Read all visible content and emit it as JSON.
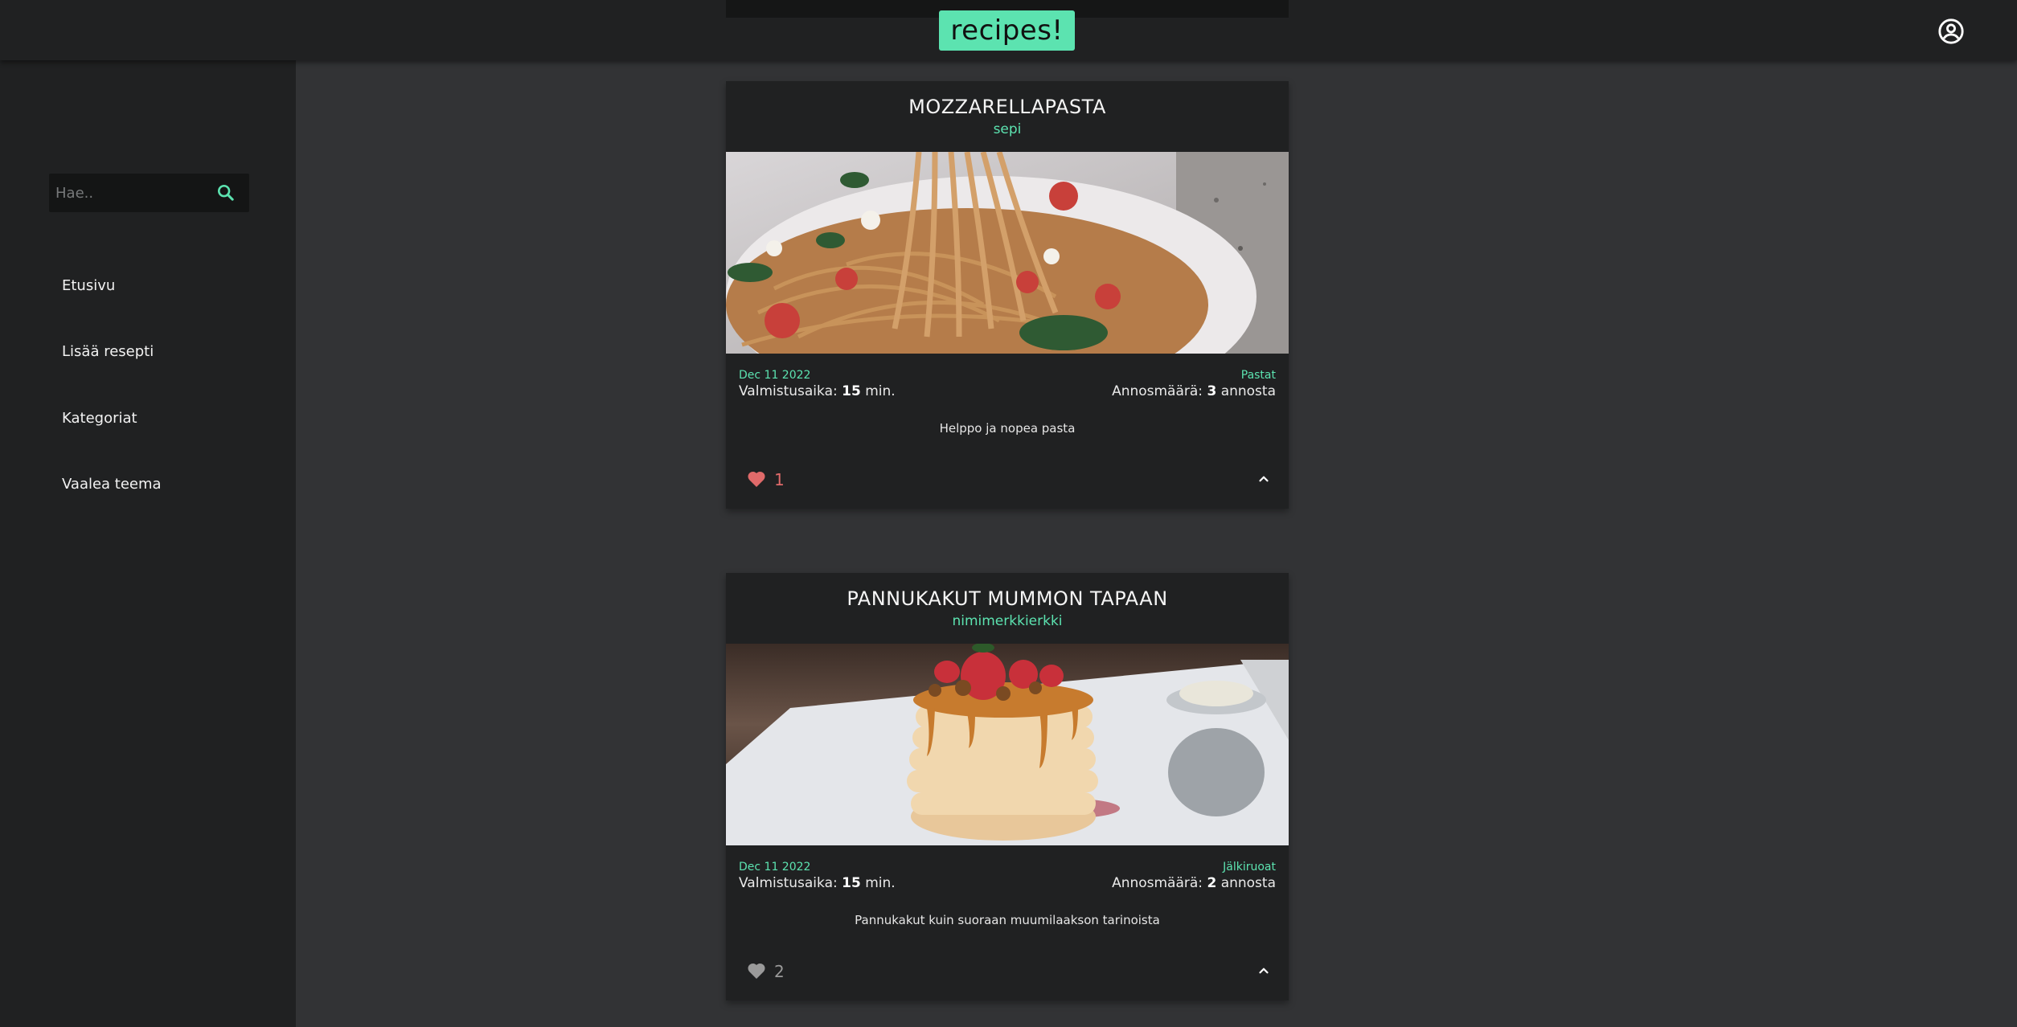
{
  "header": {
    "logo_text": "recipes!",
    "account_icon": "account-circle-icon",
    "accent_color": "#5ce3b0"
  },
  "sidebar": {
    "search": {
      "placeholder": "Hae..",
      "value": "",
      "icon": "search-icon"
    },
    "items": [
      {
        "label": "Etusivu"
      },
      {
        "label": "Lisää resepti"
      },
      {
        "label": "Kategoriat"
      },
      {
        "label": "Vaalea teema"
      }
    ]
  },
  "recipes": [
    {
      "title": "MOZZARELLAPASTA",
      "author": "sepi",
      "date": "Dec 11 2022",
      "category": "Pastat",
      "time_label": "Valmistusaika:",
      "time_value": "15",
      "time_unit": "min.",
      "servings_label": "Annosmäärä:",
      "servings_value": "3",
      "servings_unit": "annosta",
      "description": "Helppo ja nopea pasta",
      "likes": "1",
      "liked": true,
      "like_color": "#e06a6a",
      "image": "photo of spaghetti with cherry tomatoes and spinach on a fork"
    },
    {
      "title": "PANNUKAKUT MUMMON TAPAAN",
      "author": "nimimerkkierkki",
      "date": "Dec 11 2022",
      "category": "Jälkiruoat",
      "time_label": "Valmistusaika:",
      "time_value": "15",
      "time_unit": "min.",
      "servings_label": "Annosmäärä:",
      "servings_value": "2",
      "servings_unit": "annosta",
      "description": "Pannukakut kuin suoraan muumilaakson tarinoista",
      "likes": "2",
      "liked": false,
      "like_color": "#9a9a9a",
      "image": "photo of pancake stack with caramel sauce and strawberries"
    }
  ]
}
